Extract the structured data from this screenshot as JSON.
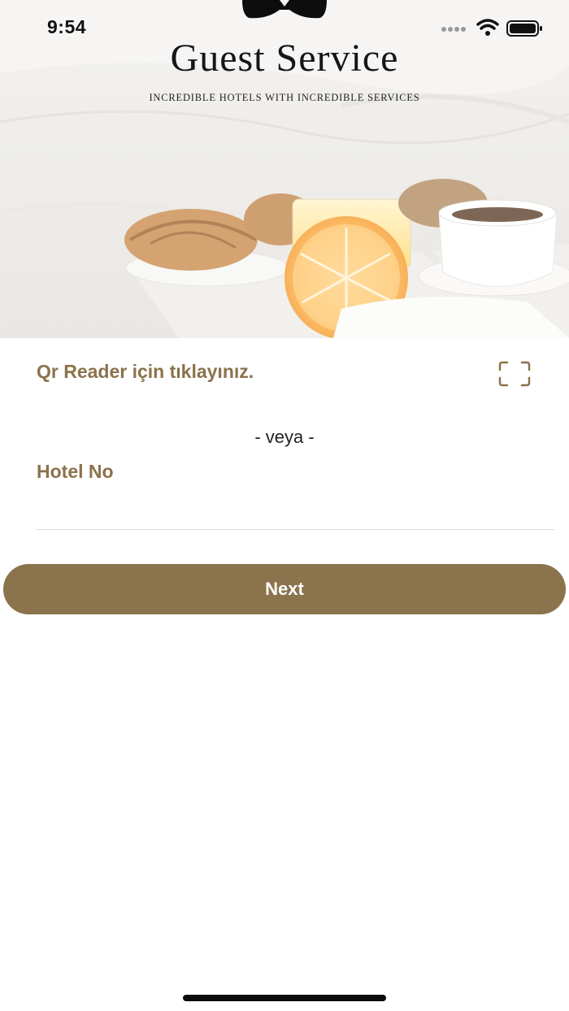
{
  "status_bar": {
    "time": "9:54",
    "icons": [
      "signal-dots-icon",
      "wifi-icon",
      "battery-icon"
    ]
  },
  "header": {
    "title": "Guest Service",
    "tagline": "INCREDIBLE HOTELS WITH INCREDIBLE SERVICES",
    "logo_icon": "bowtie-icon"
  },
  "hero": {
    "image": "breakfast-tray-photo"
  },
  "qr": {
    "label": "Qr Reader için tıklayınız.",
    "icon": "qr-scan-icon"
  },
  "separator_text": "- veya -",
  "hotel": {
    "label": "Hotel No",
    "value": "",
    "placeholder": ""
  },
  "next_button": {
    "label": "Next"
  },
  "colors": {
    "accent": "#8b734c",
    "label_text": "#8b724b"
  }
}
